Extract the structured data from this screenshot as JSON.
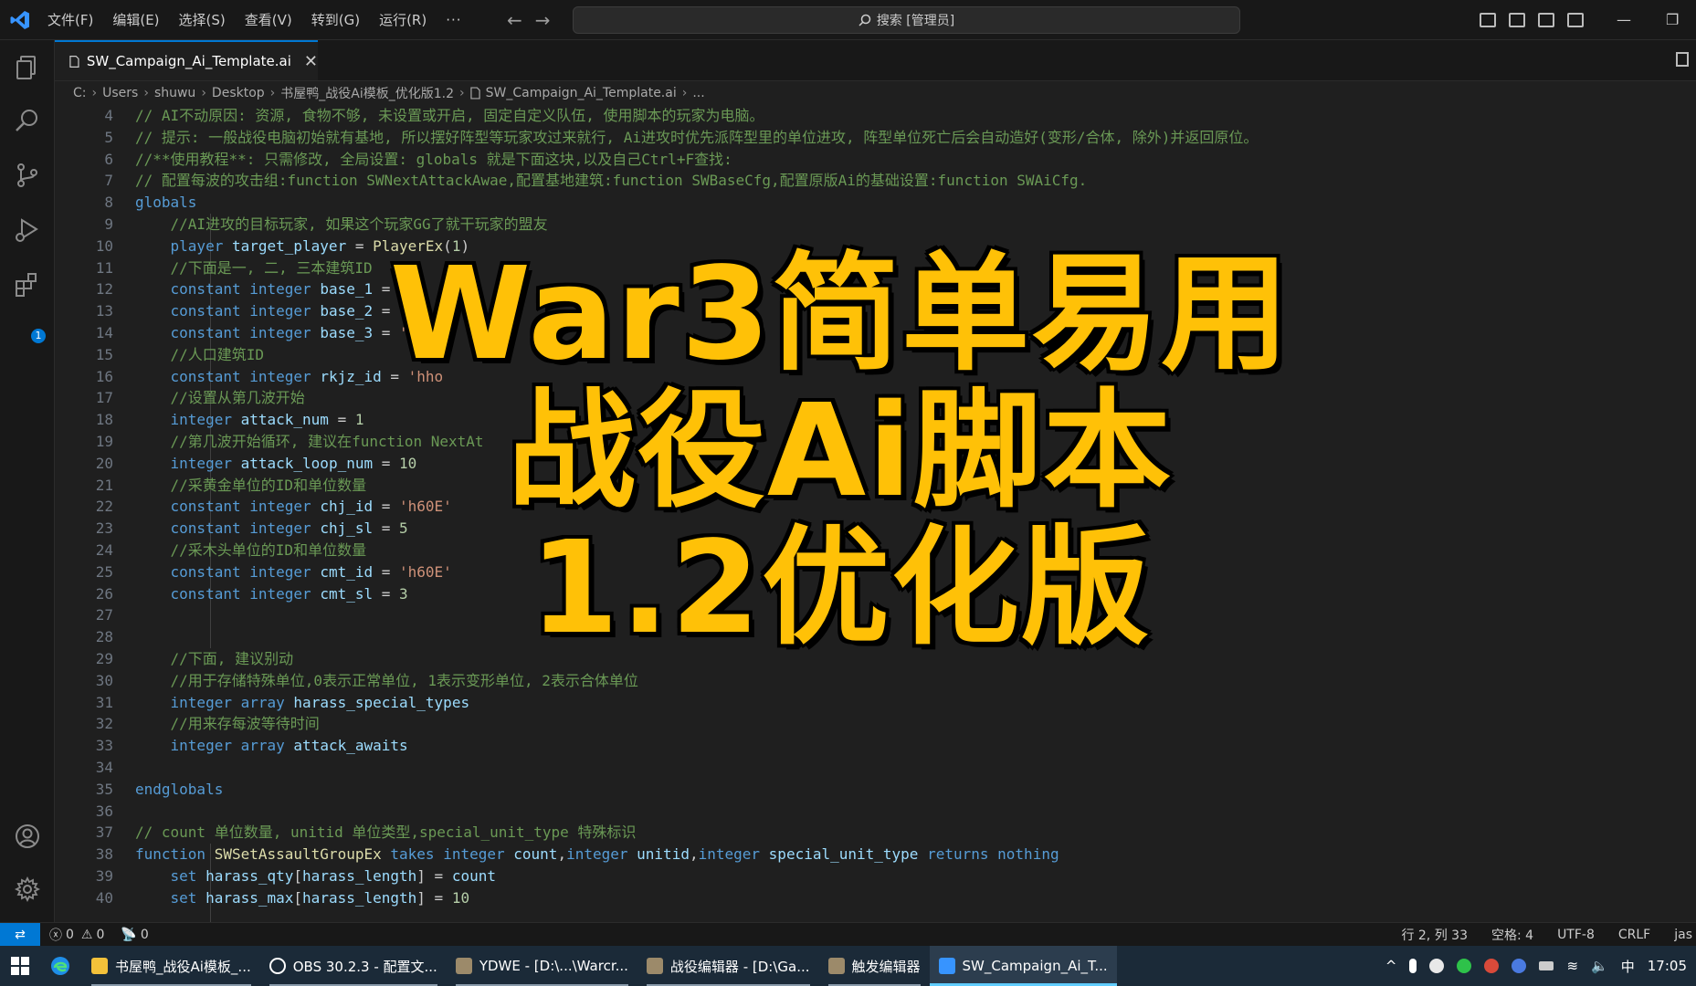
{
  "menu": {
    "items": [
      "文件(F)",
      "编辑(E)",
      "选择(S)",
      "查看(V)",
      "转到(G)",
      "运行(R)"
    ],
    "more": "···"
  },
  "search": {
    "label": "搜索 [管理员]"
  },
  "tab": {
    "label": "SW_Campaign_Ai_Template.ai"
  },
  "breadcrumb": [
    "C:",
    "Users",
    "shuwu",
    "Desktop",
    "书屋鸭_战役Ai模板_优化版1.2",
    "SW_Campaign_Ai_Template.ai",
    "..."
  ],
  "activity": {
    "extensions_badge": "1"
  },
  "editor": {
    "line_numbers": [
      "4",
      "5",
      "6",
      "7",
      "8",
      "9",
      "10",
      "11",
      "12",
      "13",
      "14",
      "15",
      "16",
      "17",
      "18",
      "19",
      "20",
      "21",
      "22",
      "23",
      "24",
      "25",
      "26",
      "27",
      "28",
      "29",
      "30",
      "31",
      "32",
      "33",
      "34",
      "35",
      "36",
      "37",
      "38",
      "39",
      "40"
    ],
    "lines": [
      [
        {
          "t": "// AI不动原因: 资源, 食物不够, 未设置或开启, 固定自定义队伍, 使用脚本的玩家为电脑。",
          "c": "cm"
        }
      ],
      [
        {
          "t": "// 提示: 一般战役电脑初始就有基地, 所以摆好阵型等玩家攻过来就行, Ai进攻时优先派阵型里的单位进攻, 阵型单位死亡后会自动造好(变形/合体, 除外)并返回原位。",
          "c": "cm"
        }
      ],
      [
        {
          "t": "//**使用教程**: 只需修改, 全局设置: globals 就是下面这块,以及自己Ctrl+F查找:",
          "c": "cm"
        }
      ],
      [
        {
          "t": "// 配置每波的攻击组:function SWNextAttackAwae,配置基地建筑:function SWBaseCfg,配置原版Ai的基础设置:function SWAiCfg.",
          "c": "cm"
        }
      ],
      [
        {
          "t": "globals",
          "c": "kw"
        }
      ],
      [
        {
          "t": "    "
        },
        {
          "t": "//AI进攻的目标玩家, 如果这个玩家GG了就干玩家的盟友",
          "c": "cm"
        }
      ],
      [
        {
          "t": "    "
        },
        {
          "t": "player",
          "c": "kw"
        },
        {
          "t": " "
        },
        {
          "t": "target_player",
          "c": "var"
        },
        {
          "t": " = "
        },
        {
          "t": "PlayerEx",
          "c": "fn"
        },
        {
          "t": "("
        },
        {
          "t": "1",
          "c": "num"
        },
        {
          "t": ")"
        }
      ],
      [
        {
          "t": "    "
        },
        {
          "t": "//下面是一, 二, 三本建筑ID",
          "c": "cm"
        }
      ],
      [
        {
          "t": "    "
        },
        {
          "t": "constant",
          "c": "kw"
        },
        {
          "t": " "
        },
        {
          "t": "integer",
          "c": "kw"
        },
        {
          "t": " "
        },
        {
          "t": "base_1",
          "c": "var"
        },
        {
          "t": " = "
        },
        {
          "t": "'h",
          "c": "str"
        }
      ],
      [
        {
          "t": "    "
        },
        {
          "t": "constant",
          "c": "kw"
        },
        {
          "t": " "
        },
        {
          "t": "integer",
          "c": "kw"
        },
        {
          "t": " "
        },
        {
          "t": "base_2",
          "c": "var"
        },
        {
          "t": " = "
        },
        {
          "t": "'h",
          "c": "str"
        }
      ],
      [
        {
          "t": "    "
        },
        {
          "t": "constant",
          "c": "kw"
        },
        {
          "t": " "
        },
        {
          "t": "integer",
          "c": "kw"
        },
        {
          "t": " "
        },
        {
          "t": "base_3",
          "c": "var"
        },
        {
          "t": " = "
        },
        {
          "t": "'h",
          "c": "str"
        }
      ],
      [
        {
          "t": "    "
        },
        {
          "t": "//人口建筑ID",
          "c": "cm"
        }
      ],
      [
        {
          "t": "    "
        },
        {
          "t": "constant",
          "c": "kw"
        },
        {
          "t": " "
        },
        {
          "t": "integer",
          "c": "kw"
        },
        {
          "t": " "
        },
        {
          "t": "rkjz_id",
          "c": "var"
        },
        {
          "t": " = "
        },
        {
          "t": "'hho",
          "c": "str"
        }
      ],
      [
        {
          "t": "    "
        },
        {
          "t": "//设置从第几波开始",
          "c": "cm"
        }
      ],
      [
        {
          "t": "    "
        },
        {
          "t": "integer",
          "c": "kw"
        },
        {
          "t": " "
        },
        {
          "t": "attack_num",
          "c": "var"
        },
        {
          "t": " = "
        },
        {
          "t": "1",
          "c": "num"
        }
      ],
      [
        {
          "t": "    "
        },
        {
          "t": "//第几波开始循环, 建议在function NextAt",
          "c": "cm"
        }
      ],
      [
        {
          "t": "    "
        },
        {
          "t": "integer",
          "c": "kw"
        },
        {
          "t": " "
        },
        {
          "t": "attack_loop_num",
          "c": "var"
        },
        {
          "t": " = "
        },
        {
          "t": "10",
          "c": "num"
        }
      ],
      [
        {
          "t": "    "
        },
        {
          "t": "//采黄金单位的ID和单位数量",
          "c": "cm"
        }
      ],
      [
        {
          "t": "    "
        },
        {
          "t": "constant",
          "c": "kw"
        },
        {
          "t": " "
        },
        {
          "t": "integer",
          "c": "kw"
        },
        {
          "t": " "
        },
        {
          "t": "chj_id",
          "c": "var"
        },
        {
          "t": " = "
        },
        {
          "t": "'h60E'",
          "c": "str"
        }
      ],
      [
        {
          "t": "    "
        },
        {
          "t": "constant",
          "c": "kw"
        },
        {
          "t": " "
        },
        {
          "t": "integer",
          "c": "kw"
        },
        {
          "t": " "
        },
        {
          "t": "chj_sl",
          "c": "var"
        },
        {
          "t": " = "
        },
        {
          "t": "5",
          "c": "num"
        }
      ],
      [
        {
          "t": "    "
        },
        {
          "t": "//采木头单位的ID和单位数量",
          "c": "cm"
        }
      ],
      [
        {
          "t": "    "
        },
        {
          "t": "constant",
          "c": "kw"
        },
        {
          "t": " "
        },
        {
          "t": "integer",
          "c": "kw"
        },
        {
          "t": " "
        },
        {
          "t": "cmt_id",
          "c": "var"
        },
        {
          "t": " = "
        },
        {
          "t": "'h60E'",
          "c": "str"
        }
      ],
      [
        {
          "t": "    "
        },
        {
          "t": "constant",
          "c": "kw"
        },
        {
          "t": " "
        },
        {
          "t": "integer",
          "c": "kw"
        },
        {
          "t": " "
        },
        {
          "t": "cmt_sl",
          "c": "var"
        },
        {
          "t": " = "
        },
        {
          "t": "3",
          "c": "num"
        }
      ],
      [
        {
          "t": ""
        }
      ],
      [
        {
          "t": ""
        }
      ],
      [
        {
          "t": "    "
        },
        {
          "t": "//下面, 建议别动",
          "c": "cm"
        }
      ],
      [
        {
          "t": "    "
        },
        {
          "t": "//用于存储特殊单位,0表示正常单位, 1表示变形单位, 2表示合体单位",
          "c": "cm"
        }
      ],
      [
        {
          "t": "    "
        },
        {
          "t": "integer",
          "c": "kw"
        },
        {
          "t": " "
        },
        {
          "t": "array",
          "c": "kw"
        },
        {
          "t": " "
        },
        {
          "t": "harass_special_types",
          "c": "var"
        }
      ],
      [
        {
          "t": "    "
        },
        {
          "t": "//用来存每波等待时间",
          "c": "cm"
        }
      ],
      [
        {
          "t": "    "
        },
        {
          "t": "integer",
          "c": "kw"
        },
        {
          "t": " "
        },
        {
          "t": "array",
          "c": "kw"
        },
        {
          "t": " "
        },
        {
          "t": "attack_awaits",
          "c": "var"
        }
      ],
      [
        {
          "t": ""
        }
      ],
      [
        {
          "t": "endglobals",
          "c": "kw"
        }
      ],
      [
        {
          "t": ""
        }
      ],
      [
        {
          "t": "// count 单位数量, unitid 单位类型,special_unit_type 特殊标识",
          "c": "cm"
        }
      ],
      [
        {
          "t": "function",
          "c": "kw"
        },
        {
          "t": " "
        },
        {
          "t": "SWSetAssaultGroupEx",
          "c": "fn"
        },
        {
          "t": " "
        },
        {
          "t": "takes",
          "c": "kw"
        },
        {
          "t": " "
        },
        {
          "t": "integer",
          "c": "kw"
        },
        {
          "t": " "
        },
        {
          "t": "count",
          "c": "var"
        },
        {
          "t": ","
        },
        {
          "t": "integer",
          "c": "kw"
        },
        {
          "t": " "
        },
        {
          "t": "unitid",
          "c": "var"
        },
        {
          "t": ","
        },
        {
          "t": "integer",
          "c": "kw"
        },
        {
          "t": " "
        },
        {
          "t": "special_unit_type",
          "c": "var"
        },
        {
          "t": " "
        },
        {
          "t": "returns",
          "c": "kw"
        },
        {
          "t": " "
        },
        {
          "t": "nothing",
          "c": "kw"
        }
      ],
      [
        {
          "t": "    "
        },
        {
          "t": "set",
          "c": "kw"
        },
        {
          "t": " "
        },
        {
          "t": "harass_qty",
          "c": "var"
        },
        {
          "t": "["
        },
        {
          "t": "harass_length",
          "c": "var"
        },
        {
          "t": "] = "
        },
        {
          "t": "count",
          "c": "var"
        }
      ],
      [
        {
          "t": "    "
        },
        {
          "t": "set",
          "c": "kw"
        },
        {
          "t": " "
        },
        {
          "t": "harass_max",
          "c": "var"
        },
        {
          "t": "["
        },
        {
          "t": "harass_length",
          "c": "var"
        },
        {
          "t": "] = "
        },
        {
          "t": "10",
          "c": "num"
        }
      ]
    ]
  },
  "overlay": {
    "line1": "War3简单易用",
    "line2": "战役Ai脚本",
    "line3": "1.2优化版"
  },
  "status": {
    "errors": "0",
    "warnings": "0",
    "ports": "0",
    "cursor": "行 2, 列 33",
    "spaces": "空格: 4",
    "encoding": "UTF-8",
    "eol": "CRLF",
    "language": "jas"
  },
  "taskbar": {
    "items": [
      "书屋鸭_战役Ai模板_...",
      "OBS 30.2.3 - 配置文...",
      "YDWE - [D:\\...\\Warcr...",
      "战役编辑器 - [D:\\Ga...",
      "触发编辑器",
      "SW_Campaign_Ai_T..."
    ],
    "ime": "中",
    "clock": "17:05"
  },
  "colors": {
    "accent": "#0078d4",
    "overlay_text": "#ffc107",
    "comment": "#6a9955",
    "keyword": "#569cd6"
  }
}
